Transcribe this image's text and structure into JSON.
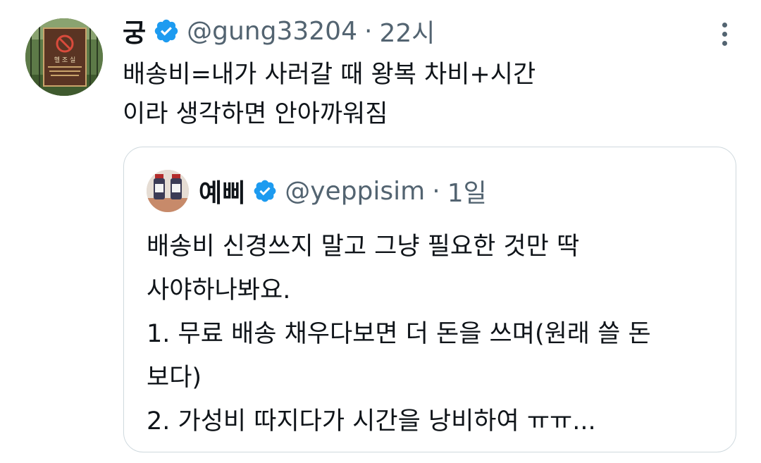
{
  "tweet": {
    "display_name": "궁",
    "handle": "@gung33204",
    "separator": "·",
    "time": "22시",
    "verified": true,
    "text_lines": [
      "배송비=내가 사러갈 때 왕복 차비+시간",
      "이라 생각하면 안아까워짐"
    ],
    "avatar_sign_text": "헬 조 실"
  },
  "quoted_tweet": {
    "display_name": "예삐",
    "handle": "@yeppisim",
    "separator": "·",
    "time": "1일",
    "verified": true,
    "text_lines": [
      "배송비 신경쓰지 말고 그냥 필요한 것만 딱",
      "사야하나봐요.",
      "1. 무료 배송 채우다보면 더 돈을 쓰며(원래 쓸 돈",
      "보다)",
      "2. 가성비 따지다가 시간을 낭비하여 ㅠㅠ..."
    ]
  },
  "icons": {
    "verified": "verified-badge-icon",
    "more": "more-options-icon"
  },
  "colors": {
    "verified_blue": "#1d9bf0",
    "secondary_text": "#536471",
    "border": "#cfd9de"
  }
}
